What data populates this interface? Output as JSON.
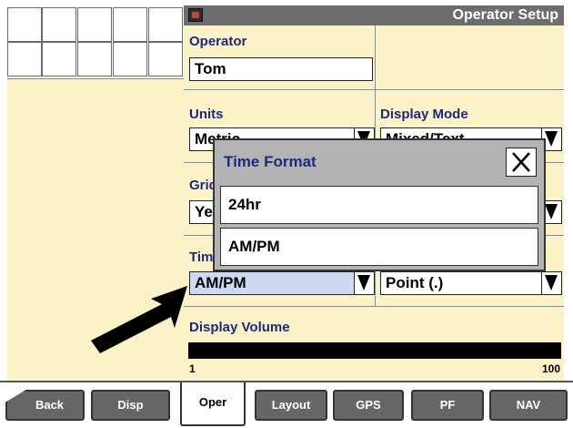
{
  "header": {
    "title": "Operator Setup"
  },
  "fields": {
    "operator": {
      "label": "Operator",
      "value": "Tom"
    },
    "units": {
      "label": "Units",
      "value": "Metric"
    },
    "display_mode": {
      "label": "Display Mode",
      "value": "Mixed/Text"
    },
    "grid": {
      "label": "Grid",
      "value": "Yes"
    },
    "time": {
      "label": "Time",
      "value": "AM/PM"
    },
    "decimal": {
      "value": "Point (.)"
    },
    "display_volume": {
      "label": "Display Volume",
      "min": "1",
      "max": "100",
      "level": 1.0
    }
  },
  "dialog": {
    "title": "Time Format",
    "options": [
      "24hr",
      "AM/PM"
    ]
  },
  "tabs": [
    "Back",
    "Disp",
    "Oper",
    "Layout",
    "GPS",
    "PF",
    "NAV"
  ],
  "active_tab": "Oper",
  "colors": {
    "panel_bg": "#fbf2c8",
    "title_bar": "#6d6d6d",
    "label_text": "#1d2a7a",
    "dialog_bg": "#b3b3b3",
    "selected_field": "#cdd8f2",
    "tab_inactive": "#666666"
  },
  "icons": {
    "title": "display-icon",
    "dropdown": "triangle-down-icon",
    "close": "close-x-icon",
    "pointer": "black-arrow-pointer"
  }
}
